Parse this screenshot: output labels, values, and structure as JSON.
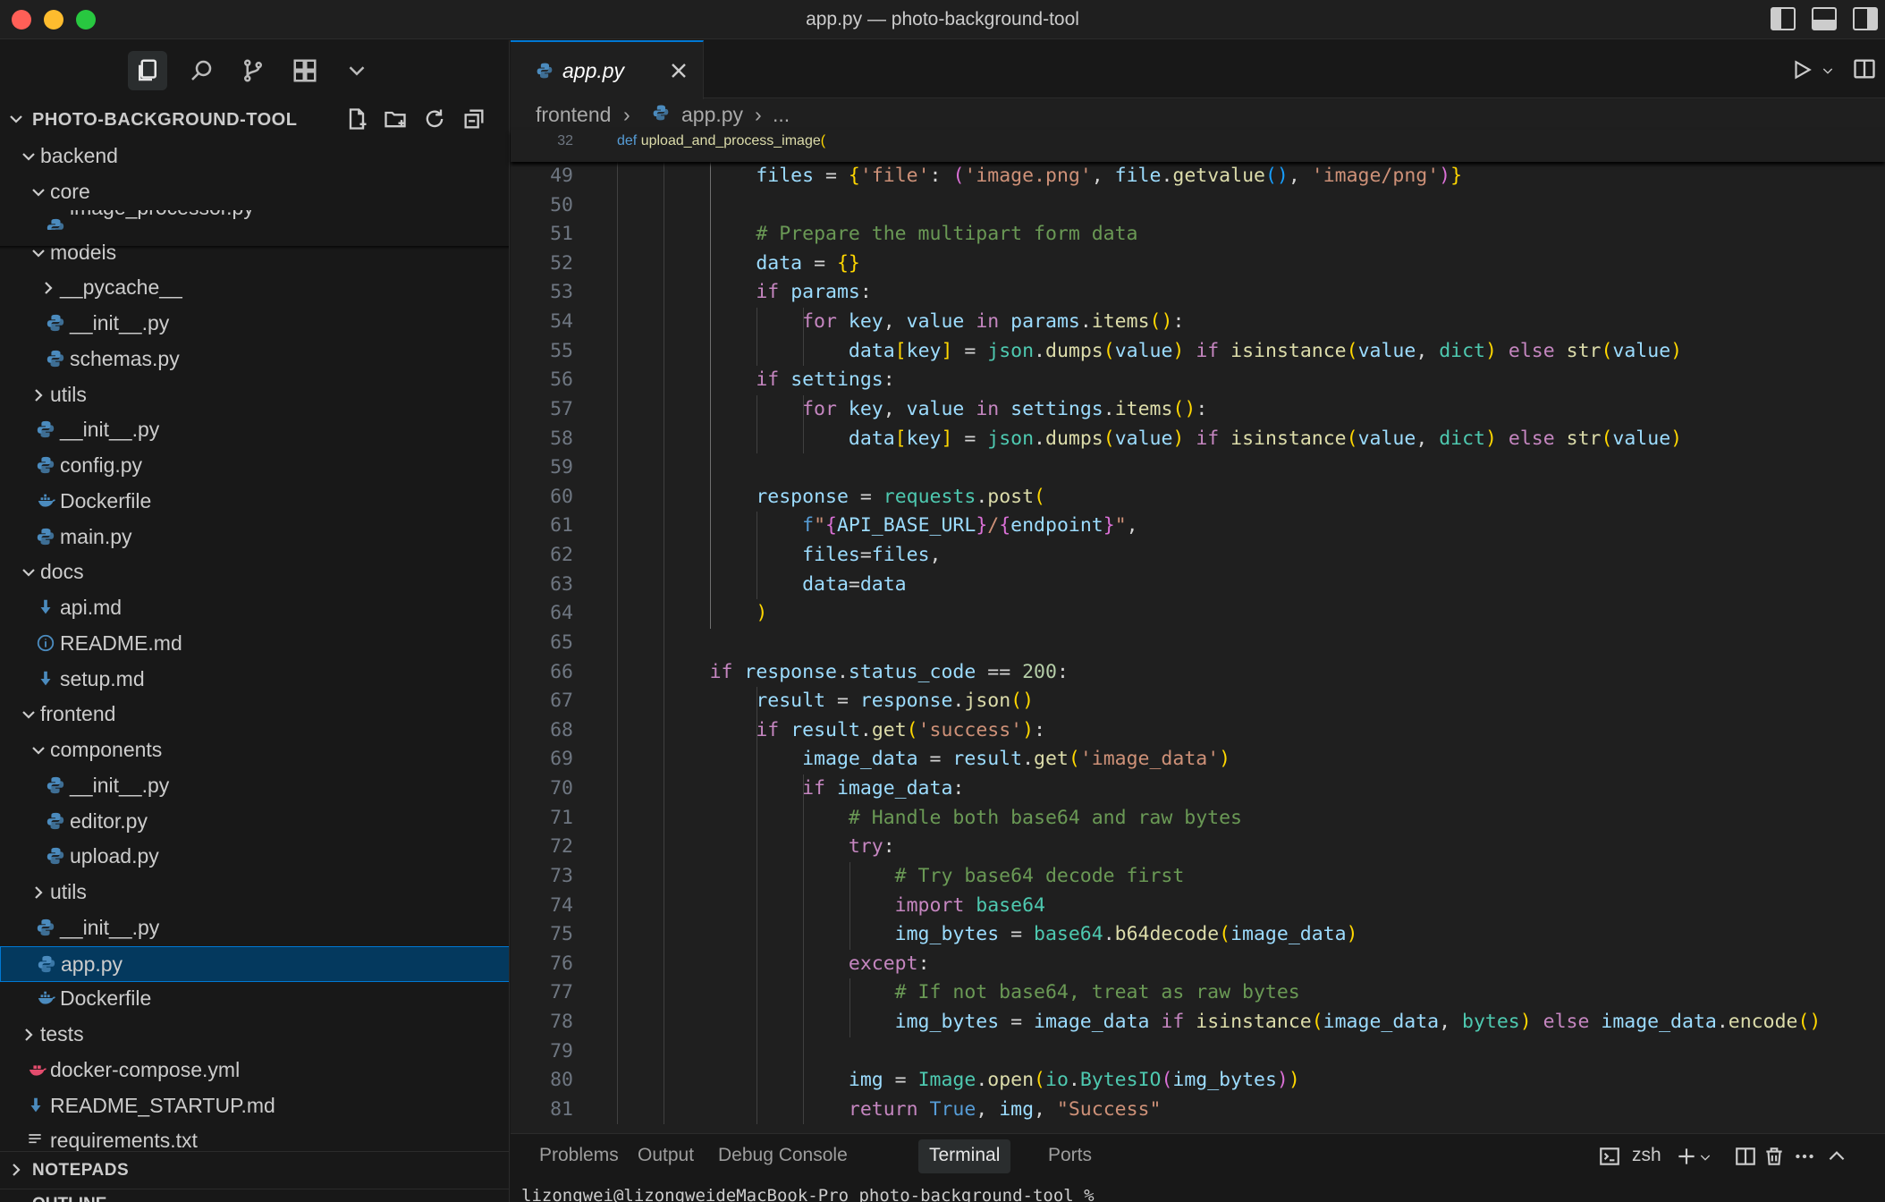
{
  "window": {
    "title": "app.py — photo-background-tool"
  },
  "explorer": {
    "root_title": "PHOTO-BACKGROUND-TOOL",
    "tree": [
      {
        "label": "backend",
        "type": "folder",
        "expanded": true
      },
      {
        "label": "core",
        "type": "folder",
        "expanded": true
      },
      {
        "label": "image_processor.py",
        "type": "python"
      },
      {
        "label": "models",
        "type": "folder",
        "expanded": true
      },
      {
        "label": "__pycache__",
        "type": "folder",
        "expanded": false
      },
      {
        "label": "__init__.py",
        "type": "python"
      },
      {
        "label": "schemas.py",
        "type": "python"
      },
      {
        "label": "utils",
        "type": "folder",
        "expanded": false
      },
      {
        "label": "__init__.py",
        "type": "python"
      },
      {
        "label": "config.py",
        "type": "python"
      },
      {
        "label": "Dockerfile",
        "type": "docker"
      },
      {
        "label": "main.py",
        "type": "python"
      },
      {
        "label": "docs",
        "type": "folder",
        "expanded": true
      },
      {
        "label": "api.md",
        "type": "markdown"
      },
      {
        "label": "README.md",
        "type": "info"
      },
      {
        "label": "setup.md",
        "type": "markdown"
      },
      {
        "label": "frontend",
        "type": "folder",
        "expanded": true
      },
      {
        "label": "components",
        "type": "folder",
        "expanded": true
      },
      {
        "label": "__init__.py",
        "type": "python"
      },
      {
        "label": "editor.py",
        "type": "python"
      },
      {
        "label": "upload.py",
        "type": "python"
      },
      {
        "label": "utils",
        "type": "folder",
        "expanded": false
      },
      {
        "label": "__init__.py",
        "type": "python"
      },
      {
        "label": "app.py",
        "type": "python",
        "selected": true
      },
      {
        "label": "Dockerfile",
        "type": "docker"
      },
      {
        "label": "tests",
        "type": "folder",
        "expanded": false
      },
      {
        "label": "docker-compose.yml",
        "type": "compose"
      },
      {
        "label": "README_STARTUP.md",
        "type": "markdown"
      },
      {
        "label": "requirements.txt",
        "type": "text"
      }
    ],
    "notepads_title": "NOTEPADS",
    "outline_title": "OUTLINE"
  },
  "editor": {
    "tab_label": "app.py",
    "breadcrumb": {
      "folder": "frontend",
      "file": "app.py",
      "more": "..."
    },
    "sticky_line": {
      "num": "32",
      "code": "def upload_and_process_image("
    },
    "lines": [
      {
        "num": "49",
        "code": "            files = {'file': ('image.png', file.getvalue(), 'image/png')}"
      },
      {
        "num": "50",
        "code": ""
      },
      {
        "num": "51",
        "code": "            # Prepare the multipart form data"
      },
      {
        "num": "52",
        "code": "            data = {}"
      },
      {
        "num": "53",
        "code": "            if params:"
      },
      {
        "num": "54",
        "code": "                for key, value in params.items():"
      },
      {
        "num": "55",
        "code": "                    data[key] = json.dumps(value) if isinstance(value, dict) else str(value)"
      },
      {
        "num": "56",
        "code": "            if settings:"
      },
      {
        "num": "57",
        "code": "                for key, value in settings.items():"
      },
      {
        "num": "58",
        "code": "                    data[key] = json.dumps(value) if isinstance(value, dict) else str(value)"
      },
      {
        "num": "59",
        "code": ""
      },
      {
        "num": "60",
        "code": "            response = requests.post("
      },
      {
        "num": "61",
        "code": "                f\"{API_BASE_URL}/{endpoint}\","
      },
      {
        "num": "62",
        "code": "                files=files,"
      },
      {
        "num": "63",
        "code": "                data=data"
      },
      {
        "num": "64",
        "code": "            )"
      },
      {
        "num": "65",
        "code": ""
      },
      {
        "num": "66",
        "code": "        if response.status_code == 200:"
      },
      {
        "num": "67",
        "code": "            result = response.json()"
      },
      {
        "num": "68",
        "code": "            if result.get('success'):"
      },
      {
        "num": "69",
        "code": "                image_data = result.get('image_data')"
      },
      {
        "num": "70",
        "code": "                if image_data:"
      },
      {
        "num": "71",
        "code": "                    # Handle both base64 and raw bytes"
      },
      {
        "num": "72",
        "code": "                    try:"
      },
      {
        "num": "73",
        "code": "                        # Try base64 decode first"
      },
      {
        "num": "74",
        "code": "                        import base64"
      },
      {
        "num": "75",
        "code": "                        img_bytes = base64.b64decode(image_data)"
      },
      {
        "num": "76",
        "code": "                    except:"
      },
      {
        "num": "77",
        "code": "                        # If not base64, treat as raw bytes"
      },
      {
        "num": "78",
        "code": "                        img_bytes = image_data if isinstance(image_data, bytes) else image_data.encode()"
      },
      {
        "num": "79",
        "code": ""
      },
      {
        "num": "80",
        "code": "                    img = Image.open(io.BytesIO(img_bytes))"
      },
      {
        "num": "81",
        "code": "                    return True, img, \"Success\""
      }
    ]
  },
  "panel": {
    "tabs": [
      "Problems",
      "Output",
      "Debug Console",
      "Terminal",
      "Ports"
    ],
    "active_tab": "Terminal",
    "terminal_name": "zsh",
    "terminal_prompt": "lizongwei@lizongweideMacBook-Pro photo-background-tool % "
  },
  "colors": {
    "accent": "#0078d4",
    "selection": "#04395e",
    "python_icon": "#4b8bbe",
    "markdown_icon": "#4b8bbe",
    "docker_icon": "#4b8bbe",
    "compose_icon": "#e34c6d"
  }
}
